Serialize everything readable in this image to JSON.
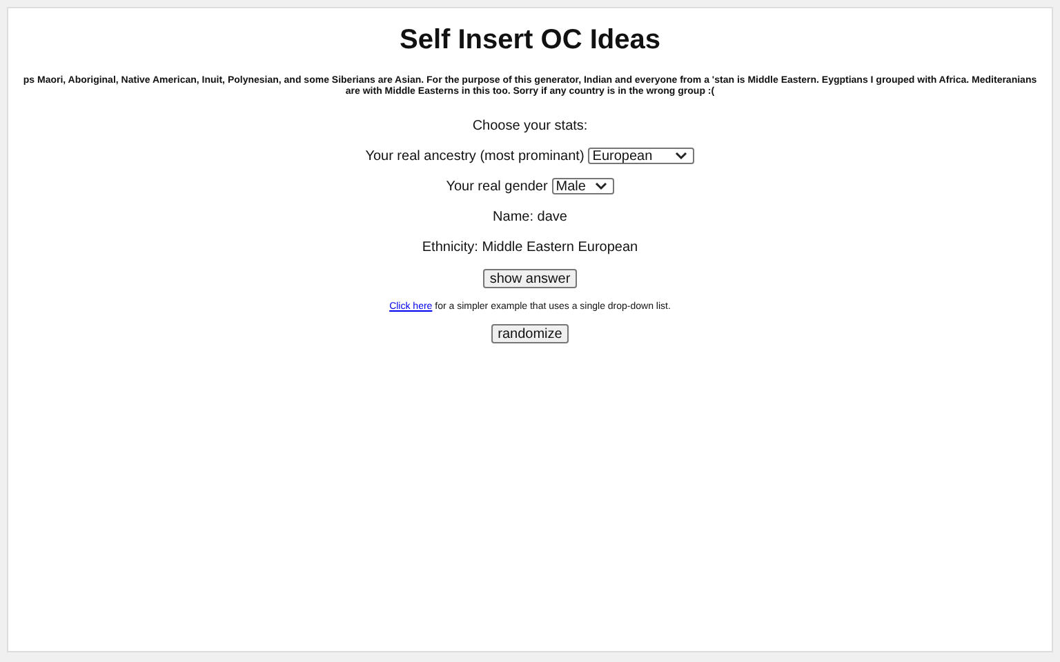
{
  "title": "Self Insert OC Ideas",
  "note": "ps Maori, Aboriginal, Native American, Inuit, Polynesian, and some Siberians are Asian. For the purpose of this generator, Indian and everyone from a 'stan is Middle Eastern. Eygptians I grouped with Africa. Mediteranians are with Middle Easterns in this too. Sorry if any country is in the wrong group :(",
  "prompt": "Choose your stats:",
  "selects": [
    {
      "label": "Your real ancestry (most prominant)",
      "value": "European"
    },
    {
      "label": "Your real gender",
      "value": "Male"
    }
  ],
  "results": [
    "Name: dave",
    "Ethnicity: Middle Eastern European"
  ],
  "show_button": "show answer",
  "link": {
    "text": "Click here",
    "rest": " for a simpler example that uses a single drop-down list."
  },
  "randomize_button": "randomize"
}
